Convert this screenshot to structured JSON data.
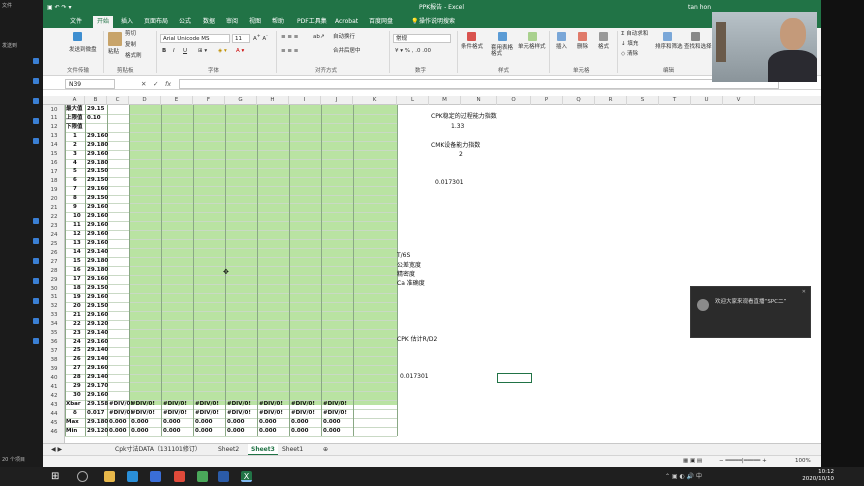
{
  "window": {
    "title": "PPK报告 - Excel",
    "user": "tan hon"
  },
  "tabs": [
    "文件",
    "开始",
    "插入",
    "页面布局",
    "公式",
    "数据",
    "审阅",
    "视图",
    "帮助",
    "PDF工具集",
    "Acrobat",
    "百度网盘",
    "操作说明搜索"
  ],
  "ribbon": {
    "clipboard": {
      "send": "发送到微盘",
      "cut": "剪切",
      "copy": "复制",
      "format_painter": "格式刷",
      "paste": "粘贴",
      "label": "剪贴板"
    },
    "file_transfer_label": "文件传输",
    "font": {
      "name": "Arial Unicode MS",
      "size": "11",
      "label": "字体"
    },
    "alignment": {
      "wrap": "自动换行",
      "merge": "合并后居中",
      "label": "对齐方式"
    },
    "number": {
      "format": "常规",
      "label": "数字"
    },
    "styles": {
      "conditional": "条件格式",
      "table": "套用表格格式",
      "cell": "单元格样式",
      "label": "样式"
    },
    "cells": {
      "insert": "插入",
      "delete": "删除",
      "format": "格式",
      "label": "单元格"
    },
    "editing": {
      "autosum": "自动求和",
      "fill": "填充",
      "clear": "清除",
      "sort": "排序和筛选",
      "find": "查找和选择",
      "label": "编辑"
    }
  },
  "formula_bar": {
    "name_box": "N39",
    "fx": "fx"
  },
  "columns": [
    "A",
    "B",
    "C",
    "D",
    "E",
    "F",
    "G",
    "H",
    "I",
    "J",
    "K",
    "L",
    "M",
    "N",
    "O",
    "P",
    "Q",
    "R",
    "S",
    "T",
    "U",
    "V"
  ],
  "rows": [
    {
      "n": "10",
      "a": "最大值",
      "b": "29.15"
    },
    {
      "n": "11",
      "a": "上限值",
      "b": "0.10"
    },
    {
      "n": "12",
      "a": "下限值",
      "b": ""
    },
    {
      "n": "13",
      "a": "1",
      "b": "29.160"
    },
    {
      "n": "14",
      "a": "2",
      "b": "29.180"
    },
    {
      "n": "15",
      "a": "3",
      "b": "29.160"
    },
    {
      "n": "16",
      "a": "4",
      "b": "29.180"
    },
    {
      "n": "17",
      "a": "5",
      "b": "29.150"
    },
    {
      "n": "18",
      "a": "6",
      "b": "29.150"
    },
    {
      "n": "19",
      "a": "7",
      "b": "29.160"
    },
    {
      "n": "20",
      "a": "8",
      "b": "29.150"
    },
    {
      "n": "21",
      "a": "9",
      "b": "29.160"
    },
    {
      "n": "22",
      "a": "10",
      "b": "29.160"
    },
    {
      "n": "23",
      "a": "11",
      "b": "29.160"
    },
    {
      "n": "24",
      "a": "12",
      "b": "29.160"
    },
    {
      "n": "25",
      "a": "13",
      "b": "29.160"
    },
    {
      "n": "26",
      "a": "14",
      "b": "29.140"
    },
    {
      "n": "27",
      "a": "15",
      "b": "29.180"
    },
    {
      "n": "28",
      "a": "16",
      "b": "29.180"
    },
    {
      "n": "29",
      "a": "17",
      "b": "29.160"
    },
    {
      "n": "30",
      "a": "18",
      "b": "29.150"
    },
    {
      "n": "31",
      "a": "19",
      "b": "29.160"
    },
    {
      "n": "32",
      "a": "20",
      "b": "29.150"
    },
    {
      "n": "33",
      "a": "21",
      "b": "29.160"
    },
    {
      "n": "34",
      "a": "22",
      "b": "29.120"
    },
    {
      "n": "35",
      "a": "23",
      "b": "29.140"
    },
    {
      "n": "36",
      "a": "24",
      "b": "29.160"
    },
    {
      "n": "37",
      "a": "25",
      "b": "29.140"
    },
    {
      "n": "38",
      "a": "26",
      "b": "29.140"
    },
    {
      "n": "39",
      "a": "27",
      "b": "29.160"
    },
    {
      "n": "40",
      "a": "28",
      "b": "29.140"
    },
    {
      "n": "41",
      "a": "29",
      "b": "29.170"
    },
    {
      "n": "42",
      "a": "30",
      "b": "29.160"
    }
  ],
  "stats": [
    {
      "n": "43",
      "a": "Xbar",
      "b": "29.158",
      "rest": "#DIV/0!"
    },
    {
      "n": "44",
      "a": "δ",
      "b": "0.017",
      "rest": "#DIV/0!"
    },
    {
      "n": "45",
      "a": "Max",
      "b": "29.180",
      "rest": "0.000"
    },
    {
      "n": "46",
      "a": "Min",
      "b": "29.120",
      "rest": "0.000"
    }
  ],
  "notes": {
    "cpk_title": "CPK稳定的过程能力指数",
    "cpk_value": "1.33",
    "cmk_title": "CMK设备能力指数",
    "cmk_value": "2",
    "value_a": "0.017301",
    "t6s": "T/6S",
    "tolerance": "公差宽度",
    "precision": "精密度",
    "ca": "Ca 准确度",
    "cpk_est": "CPK 估计R/D2",
    "value_b": "0.017301"
  },
  "sheets": [
    "Cpk寸法DATA（131101修订）",
    "Sheet2",
    "Sheet3",
    "Sheet1"
  ],
  "status": {
    "zoom": "100%"
  },
  "notification": {
    "text": "欢迎大家来观看直播“SPC二”"
  },
  "clock": {
    "time": "10:12",
    "date": "2020/10/10"
  },
  "left_pane": [
    "文件",
    "发送到",
    "20",
    "20",
    "20",
    "20",
    "20",
    "20",
    "20",
    "20",
    "20",
    "20",
    "20 个项目"
  ],
  "colors": {
    "excel_green": "#217346",
    "cell_green": "#b9e3a2"
  }
}
